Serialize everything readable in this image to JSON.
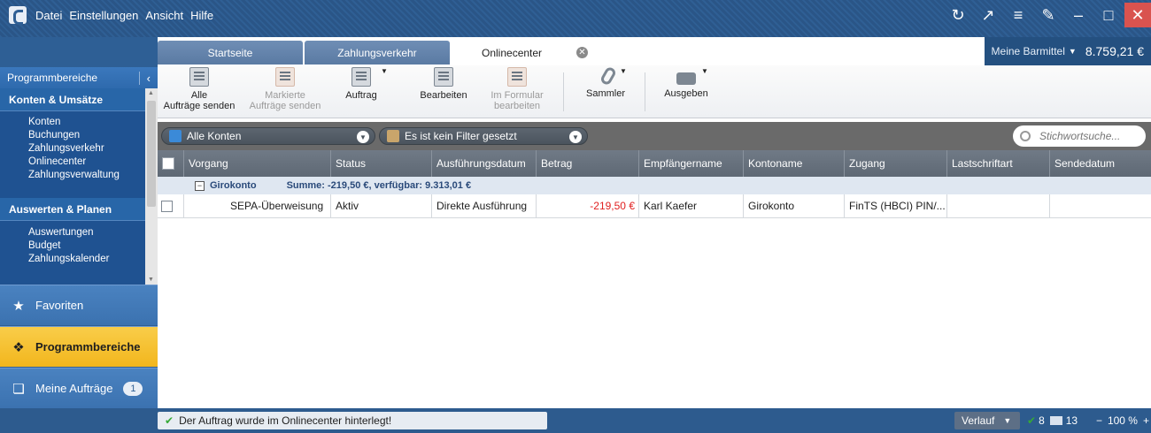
{
  "menu": [
    "Datei",
    "Einstellungen",
    "Ansicht",
    "Hilfe"
  ],
  "tabs": [
    {
      "label": "Startseite"
    },
    {
      "label": "Zahlungsverkehr"
    },
    {
      "label": "Onlinecenter",
      "active": true
    }
  ],
  "cash": {
    "label": "Meine Barmittel",
    "value": "8.759,21 €"
  },
  "sidebar": {
    "header": "Programmbereiche",
    "groups": [
      {
        "title": "Konten & Umsätze",
        "items": [
          "Konten",
          "Buchungen",
          "Zahlungsverkehr",
          "Onlinecenter",
          "Zahlungsverwaltung"
        ]
      },
      {
        "title": "Auswerten & Planen",
        "items": [
          "Auswertungen",
          "Budget",
          "Zahlungskalender"
        ]
      }
    ],
    "nav": [
      {
        "label": "Favoriten",
        "icon": "star-icon"
      },
      {
        "label": "Programmbereiche",
        "icon": "puzzle-icon",
        "active": true
      },
      {
        "label": "Meine Aufträge",
        "icon": "box-icon",
        "badge": "1"
      }
    ]
  },
  "ribbon": {
    "send_all": {
      "line1": "Alle",
      "line2": "Aufträge senden"
    },
    "send_marked": {
      "line1": "Markierte",
      "line2": "Aufträge senden"
    },
    "order": "Auftrag",
    "edit": "Bearbeiten",
    "in_form": {
      "line1": "Im Formular",
      "line2": "bearbeiten"
    },
    "collector": "Sammler",
    "output": "Ausgeben"
  },
  "filters": {
    "accounts": "Alle Konten",
    "filter": "Es ist kein Filter gesetzt",
    "search_placeholder": "Stichwortsuche..."
  },
  "table": {
    "columns": [
      "Vorgang",
      "Status",
      "Ausführungsdatum",
      "Betrag",
      "Empfängername",
      "Kontoname",
      "Zugang",
      "Lastschriftart",
      "Sendedatum"
    ],
    "group": {
      "name": "Girokonto",
      "summary": "Summe:  -219,50 €,  verfügbar:  9.313,01 €"
    },
    "rows": [
      {
        "vorgang": "SEPA-Überweisung",
        "status": "Aktiv",
        "datum": "Direkte Ausführung",
        "betrag": "-219,50 €",
        "empfaenger": "Karl Kaefer",
        "konto": "Girokonto",
        "zugang": "FinTS (HBCI) PIN/...",
        "lastschrift": "",
        "sendedatum": ""
      }
    ]
  },
  "status": {
    "message": "Der Auftrag wurde im Onlinecenter hinterlegt!",
    "history": "Verlauf",
    "ok_count": "8",
    "mail_count": "13",
    "zoom": "100 %"
  },
  "colors": {
    "accent": "#2e5f95",
    "active_nav": "#f2b61d",
    "negative": "#e02020"
  }
}
